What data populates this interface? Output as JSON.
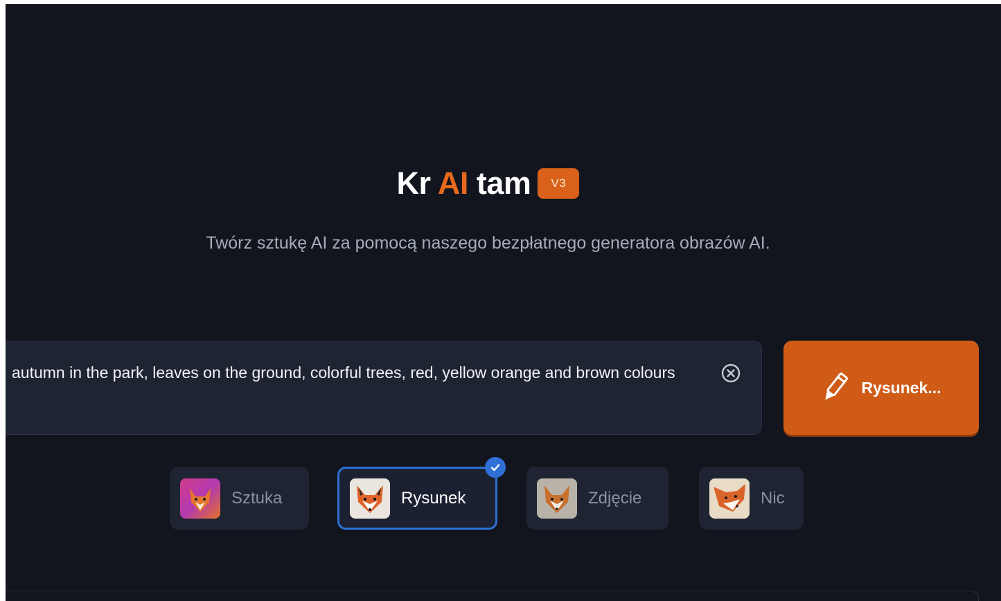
{
  "header": {
    "title_part1": "Kr",
    "title_accent": "AI",
    "title_part2": "tam",
    "version_badge": "V3",
    "subtitle": "Twórz sztukę AI za pomocą naszego bezpłatnego generatora obrazów AI."
  },
  "prompt": {
    "value": "autumn in the park, leaves on the ground, colorful trees, red, yellow orange and brown colours",
    "clear_icon": "close-circle-icon"
  },
  "generate_button": {
    "label": "Rysunek...",
    "icon": "pencil-icon"
  },
  "styles": {
    "selected": "Rysunek",
    "items": [
      {
        "label": "Sztuka",
        "icon": "fox-art-thumbnail"
      },
      {
        "label": "Rysunek",
        "icon": "fox-drawing-thumbnail"
      },
      {
        "label": "Zdjęcie",
        "icon": "fox-photo-thumbnail"
      },
      {
        "label": "Nic",
        "icon": "fox-none-thumbnail"
      }
    ]
  },
  "colors": {
    "background": "#12151d",
    "accent": "#cf5b16",
    "selected_border": "#2f6fd6",
    "panel": "#1f2433"
  }
}
